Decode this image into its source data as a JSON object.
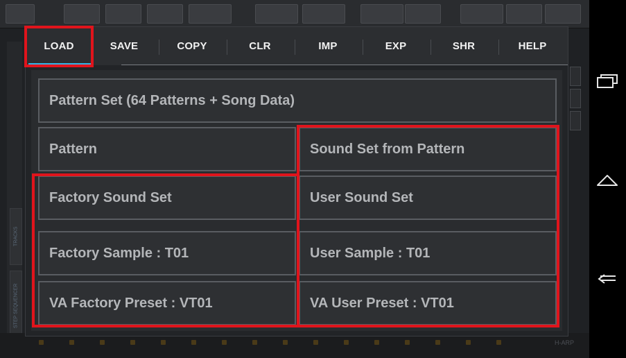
{
  "tabs": [
    {
      "label": "LOAD",
      "active": true
    },
    {
      "label": "SAVE"
    },
    {
      "label": "COPY"
    },
    {
      "label": "CLR"
    },
    {
      "label": "IMP"
    },
    {
      "label": "EXP"
    },
    {
      "label": "SHR"
    },
    {
      "label": "HELP"
    }
  ],
  "options": {
    "pattern_set": "Pattern Set (64 Patterns + Song Data)",
    "pattern": "Pattern",
    "sound_set_from_pattern": "Sound Set from Pattern",
    "factory_sound_set": "Factory Sound Set",
    "user_sound_set": "User Sound Set",
    "factory_sample": "Factory Sample : T01",
    "user_sample": "User Sample : T01",
    "va_factory_preset": "VA Factory Preset : VT01",
    "va_user_preset": "VA User Preset : VT01"
  },
  "background": {
    "side_tabs": [
      "TRACKS",
      "STEP SEQUENCER"
    ],
    "bottom_label": "H-ARP"
  },
  "colors": {
    "accent": "#33b5e5",
    "highlight": "#e0141c"
  },
  "nav": {
    "icons": [
      "recent-apps-icon",
      "home-icon",
      "back-icon"
    ]
  }
}
